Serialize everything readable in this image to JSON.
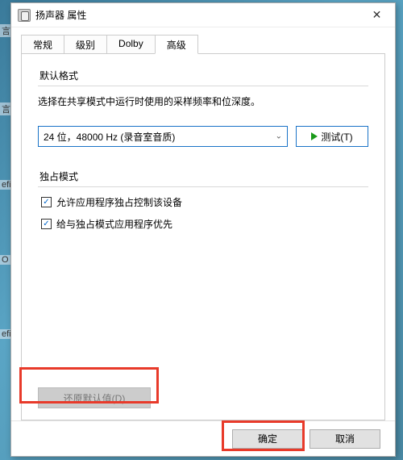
{
  "window": {
    "title": "扬声器 属性"
  },
  "tabs": [
    {
      "label": "常规"
    },
    {
      "label": "级别"
    },
    {
      "label": "Dolby"
    },
    {
      "label": "高级"
    }
  ],
  "defaultFormat": {
    "groupLabel": "默认格式",
    "description": "选择在共享模式中运行时使用的采样频率和位深度。",
    "selected": "24 位，48000 Hz (录音室音质)",
    "testButton": "测试(T)"
  },
  "exclusive": {
    "groupLabel": "独占模式",
    "options": [
      {
        "checked": true,
        "label": "允许应用程序独占控制该设备"
      },
      {
        "checked": true,
        "label": "给与独占模式应用程序优先"
      }
    ]
  },
  "restoreDefaults": "还原默认值(D)",
  "buttons": {
    "ok": "确定",
    "cancel": "取消"
  },
  "bgHints": [
    "言",
    "言",
    "efi",
    "O",
    "efi"
  ]
}
